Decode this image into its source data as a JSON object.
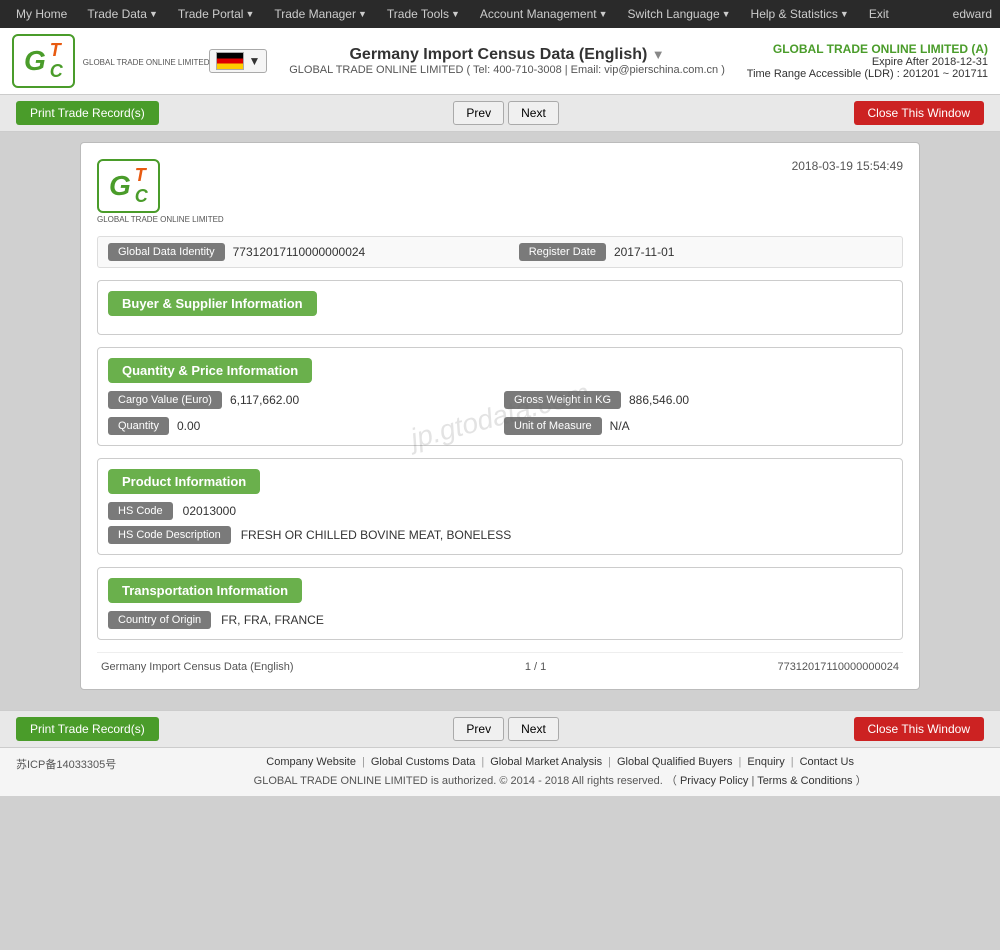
{
  "topnav": {
    "items": [
      "My Home",
      "Trade Data",
      "Trade Portal",
      "Trade Manager",
      "Trade Tools",
      "Account Management",
      "Switch Language",
      "Help & Statistics",
      "Exit"
    ],
    "user": "edward"
  },
  "header": {
    "logo_sub": "GLOBAL TRADE ONLINE LIMITED",
    "flag_alt": "Germany",
    "title": "Germany Import Census Data (English)",
    "contact": "GLOBAL TRADE ONLINE LIMITED ( Tel: 400-710-3008 | Email: vip@pierschina.com.cn )",
    "company_name": "GLOBAL TRADE ONLINE LIMITED (A)",
    "expire": "Expire After 2018-12-31",
    "ldr": "Time Range Accessible (LDR) : 201201 ~ 201711"
  },
  "toolbar": {
    "print_label": "Print Trade Record(s)",
    "prev_label": "Prev",
    "next_label": "Next",
    "close_label": "Close This Window"
  },
  "record": {
    "timestamp": "2018-03-19 15:54:49",
    "global_data_identity_label": "Global Data Identity",
    "global_data_identity_value": "77312017110000000024",
    "register_date_label": "Register Date",
    "register_date_value": "2017-11-01",
    "sections": {
      "buyer_supplier": {
        "title": "Buyer & Supplier Information"
      },
      "quantity_price": {
        "title": "Quantity & Price Information",
        "fields": [
          {
            "label": "Cargo Value (Euro)",
            "value": "6,117,662.00"
          },
          {
            "label": "Gross Weight in KG",
            "value": "886,546.00"
          },
          {
            "label": "Quantity",
            "value": "0.00"
          },
          {
            "label": "Unit of Measure",
            "value": "N/A"
          }
        ]
      },
      "product": {
        "title": "Product Information",
        "fields": [
          {
            "label": "HS Code",
            "value": "02013000"
          },
          {
            "label": "HS Code Description",
            "value": "FRESH OR CHILLED BOVINE MEAT, BONELESS"
          }
        ]
      },
      "transportation": {
        "title": "Transportation Information",
        "fields": [
          {
            "label": "Country of Origin",
            "value": "FR, FRA, FRANCE"
          }
        ]
      }
    },
    "footer": {
      "left": "Germany Import Census Data (English)",
      "center": "1 / 1",
      "right": "77312017110000000024"
    }
  },
  "watermark": "jp.gtodata.com",
  "site_footer": {
    "icp": "苏ICP备14033305号",
    "links": [
      "Company Website",
      "Global Customs Data",
      "Global Market Analysis",
      "Global Qualified Buyers",
      "Enquiry",
      "Contact Us"
    ],
    "copyright": "GLOBAL TRADE ONLINE LIMITED is authorized. © 2014 - 2018 All rights reserved. （",
    "privacy": "Privacy Policy",
    "terms": "Terms & Conditions",
    "end": "）"
  }
}
